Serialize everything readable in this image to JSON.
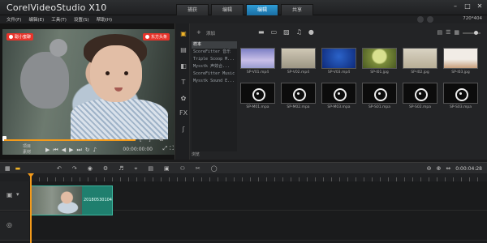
{
  "app": {
    "title_prefix": "Corel",
    "title_main": "VideoStudio X10"
  },
  "tabs": [
    {
      "label": "捕获"
    },
    {
      "label": "编辑"
    },
    {
      "label": "编辑",
      "active": true
    },
    {
      "label": "共享"
    }
  ],
  "menu": [
    "文件(F)",
    "编辑(E)",
    "工具(T)",
    "设置(S)",
    "帮助(H)"
  ],
  "resolution": "720*404",
  "player": {
    "badge_left": "聪小蜜聊",
    "badge_right": "东方头条",
    "mode_labels": [
      "项目",
      "素材"
    ],
    "timecode": "00:00:00:00"
  },
  "library": {
    "add_label": "添加",
    "folders": [
      {
        "label": "样本",
        "selected": true
      },
      {
        "label": "ScoreFitter 音乐"
      },
      {
        "label": "Triple Scoop M..."
      },
      {
        "label": "Mysstk 声效合..."
      },
      {
        "label": "ScoreFitter Music"
      },
      {
        "label": "Mysstk Sound E..."
      }
    ],
    "browse_label": "浏览",
    "items": [
      {
        "label": "SP-V01.mp4",
        "kind": "t0"
      },
      {
        "label": "SP-V02.mp4",
        "kind": "t1"
      },
      {
        "label": "SP-V03.mp4",
        "kind": "t2"
      },
      {
        "label": "SP-I01.jpg",
        "kind": "t3"
      },
      {
        "label": "SP-I02.jpg",
        "kind": "t4"
      },
      {
        "label": "SP-I03.jpg",
        "kind": "t5"
      },
      {
        "label": "SP-M01.mpa",
        "kind": "disc"
      },
      {
        "label": "SP-M02.mpa",
        "kind": "disc"
      },
      {
        "label": "SP-M03.mpa",
        "kind": "disc"
      },
      {
        "label": "SP-S01.mpa",
        "kind": "disc"
      },
      {
        "label": "SP-S02.mpa",
        "kind": "disc"
      },
      {
        "label": "SP-S03.mpa",
        "kind": "disc"
      }
    ]
  },
  "timeline": {
    "time": "0:00:04:28",
    "clip_label": "20180530104"
  }
}
